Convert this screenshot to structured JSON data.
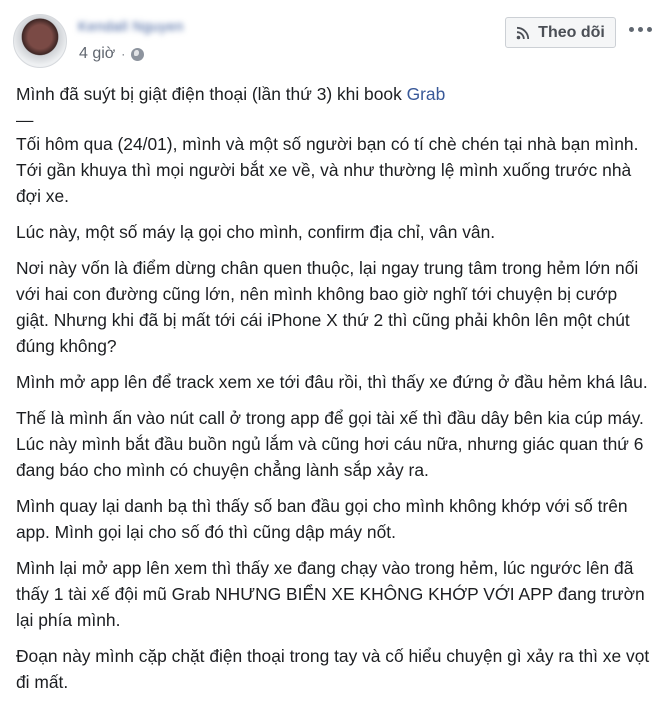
{
  "author": {
    "name": "Kendall Nguyen",
    "timestamp": "4 giờ",
    "separator": "·",
    "privacy_icon": "globe-icon"
  },
  "header": {
    "follow_label": "Theo dõi",
    "follow_icon": "feed-icon",
    "more_icon": "more-icon"
  },
  "post": {
    "title_text": "Mình đã suýt bị giật điện thoại (lần thứ 3) khi book ",
    "title_tag": "Grab",
    "separator": "—",
    "paragraphs": [
      "Tối hôm qua (24/01), mình và một số người bạn có tí chè chén tại nhà bạn mình. Tới gần khuya thì mọi người bắt xe về, và như thường lệ mình xuống trước nhà đợi xe.",
      "Lúc này, một số máy lạ gọi cho mình, confirm địa chỉ, vân vân.",
      "Nơi này vốn là điểm dừng chân quen thuộc, lại ngay trung tâm trong hẻm lớn nối với hai con đường cũng lớn, nên mình không bao giờ nghĩ tới chuyện bị cướp giật. Nhưng khi đã bị mất tới cái iPhone X thứ 2 thì cũng phải khôn lên một chút đúng không?",
      "Mình mở app lên để track xem xe tới đâu rồi, thì thấy xe đứng ở đầu hẻm khá lâu.",
      "Thế là mình ấn vào nút call ở trong app để gọi tài xế thì đầu dây bên kia cúp máy. Lúc này mình bắt đầu buồn ngủ lắm và cũng hơi cáu nữa, nhưng giác quan thứ 6 đang báo cho mình có chuyện chẳng lành sắp xảy ra.",
      "Mình quay lại danh bạ thì thấy số ban đầu gọi cho mình không khớp với số trên app. Mình gọi lại cho số đó thì cũng dập máy nốt.",
      "Mình lại mở app lên xem thì thấy xe đang chạy vào trong hẻm, lúc ngước lên đã thấy 1 tài xế đội mũ Grab NHƯNG BIỂN XE KHÔNG KHỚP VỚI APP đang trườn lại phía mình.",
      "Đoạn này mình cặp chặt điện thoại trong tay và cố hiểu chuyện gì xảy ra thì xe vọt đi mất."
    ]
  },
  "colors": {
    "link": "#385898",
    "text": "#1c1e21",
    "meta": "#616770",
    "button_bg": "#f5f6f7",
    "button_border": "#ccd0d5"
  }
}
